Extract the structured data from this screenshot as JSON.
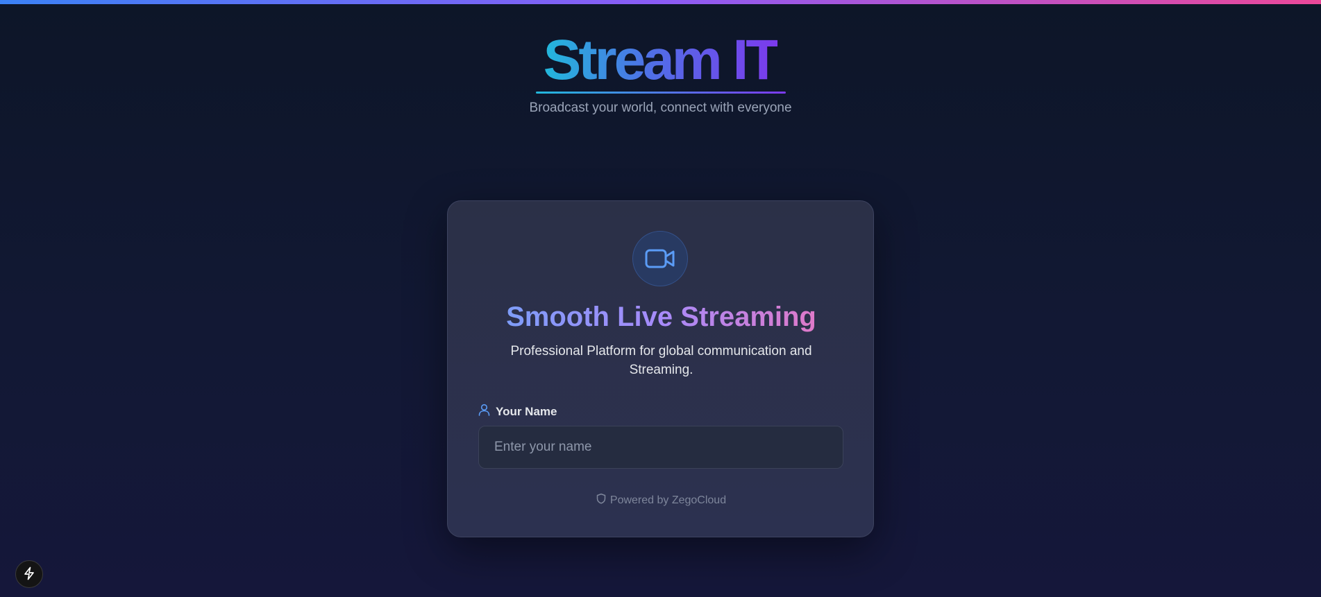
{
  "brand": {
    "logo_text": "Stream IT",
    "tagline": "Broadcast your world, connect with everyone"
  },
  "card": {
    "icon": "video-camera-icon",
    "title": "Smooth Live Streaming",
    "subtitle": "Professional Platform for global communication and Streaming.",
    "name_label": "Your Name",
    "name_input": {
      "value": "",
      "placeholder": "Enter your name"
    },
    "powered_by": "Powered by ZegoCloud"
  },
  "floating": {
    "icon": "lightning-bolt-icon"
  },
  "colors": {
    "background": "#0d1628",
    "accent_blue": "#3b82f6",
    "accent_purple": "#8b5cf6",
    "accent_pink": "#ec4899",
    "logo_cyan": "#22b8dc",
    "logo_violet": "#7c3aed"
  }
}
